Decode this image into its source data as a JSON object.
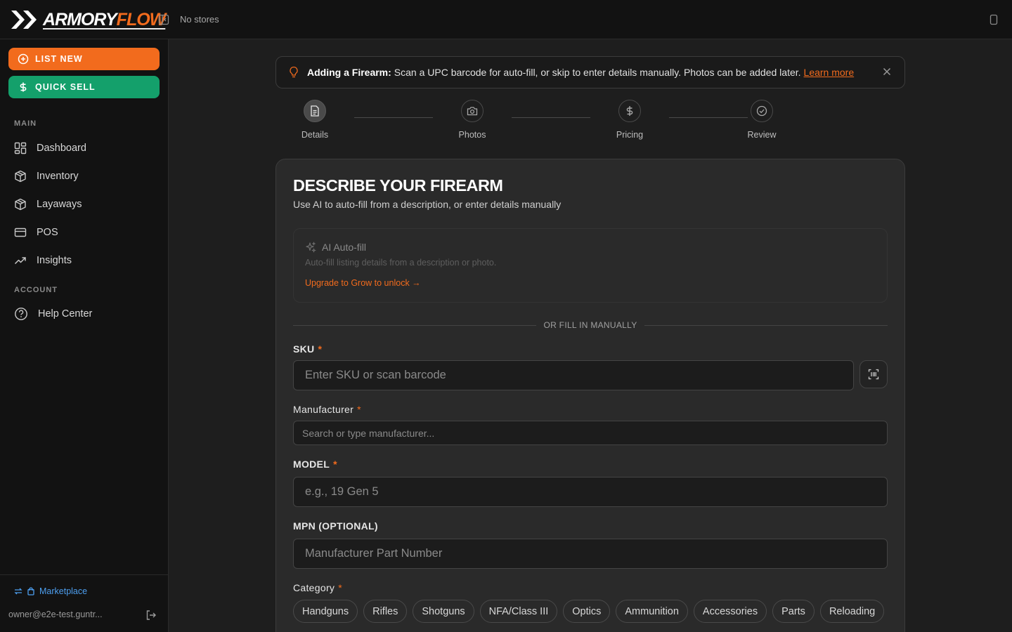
{
  "app": {
    "logo_armory": "ARMORY",
    "logo_flow": "FLOW",
    "store_label": "No stores",
    "brand_color": "#f26b1d",
    "sell_color": "#14a06b"
  },
  "sidebar": {
    "list_new": "LIST NEW",
    "quick_sell": "QUICK SELL",
    "main_label": "MAIN",
    "items": [
      {
        "label": "Dashboard",
        "icon": "dashboard-icon"
      },
      {
        "label": "Inventory",
        "icon": "box-icon"
      },
      {
        "label": "Layaways",
        "icon": "box-icon"
      },
      {
        "label": "POS",
        "icon": "card-icon"
      },
      {
        "label": "Insights",
        "icon": "trending-up-icon"
      }
    ],
    "account_label": "ACCOUNT",
    "help": {
      "label": "Help Center",
      "icon": "help-circle-icon"
    },
    "marketplace": "Marketplace",
    "user_email": "owner@e2e-test.guntr..."
  },
  "banner": {
    "title": "Adding a Firearm:",
    "text": "Scan a UPC barcode for auto-fill, or skip to enter details manually. Photos can be added later.",
    "link": "Learn more"
  },
  "stepper": {
    "steps": [
      {
        "label": "Details",
        "icon": "document-icon",
        "active": true
      },
      {
        "label": "Photos",
        "icon": "camera-icon",
        "active": false
      },
      {
        "label": "Pricing",
        "icon": "dollar-icon",
        "active": false
      },
      {
        "label": "Review",
        "icon": "check-circle-icon",
        "active": false
      }
    ]
  },
  "form": {
    "title": "DESCRIBE YOUR FIREARM",
    "subtitle": "Use AI to auto-fill from a description, or enter details manually",
    "ai": {
      "title": "AI Auto-fill",
      "desc": "Auto-fill listing details from a description or photo.",
      "upgrade": "Upgrade to Grow to unlock →"
    },
    "divider": "OR FILL IN MANUALLY",
    "sku": {
      "label": "SKU",
      "placeholder": "Enter SKU or scan barcode"
    },
    "manufacturer": {
      "label": "Manufacturer",
      "placeholder": "Search or type manufacturer..."
    },
    "model": {
      "label": "MODEL",
      "placeholder": "e.g., 19 Gen 5"
    },
    "mpn": {
      "label": "MPN (OPTIONAL)",
      "placeholder": "Manufacturer Part Number"
    },
    "category": {
      "label": "Category",
      "options": [
        "Handguns",
        "Rifles",
        "Shotguns",
        "NFA/Class III",
        "Optics",
        "Ammunition",
        "Accessories",
        "Parts",
        "Reloading"
      ]
    },
    "required_mark": "*"
  }
}
